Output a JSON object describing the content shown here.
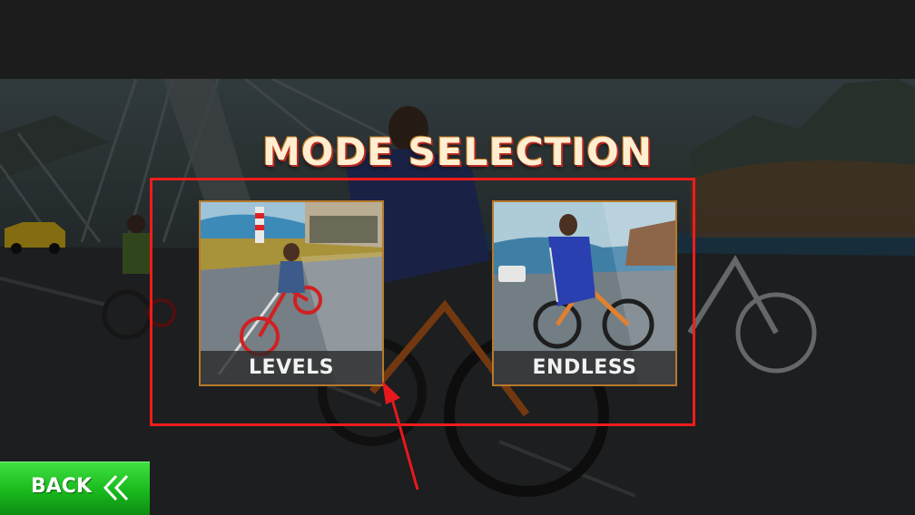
{
  "screen": {
    "title": "MODE SELECTION"
  },
  "modes": [
    {
      "label": "LEVELS"
    },
    {
      "label": "ENDLESS"
    }
  ],
  "back_button": {
    "label": "BACK",
    "icon": "double-chevron-left-icon"
  },
  "colors": {
    "highlight_border": "#ee1c1c",
    "back_green": "#19b91d",
    "card_border": "#b8792c",
    "annotation_arrow": "#e8181e"
  }
}
